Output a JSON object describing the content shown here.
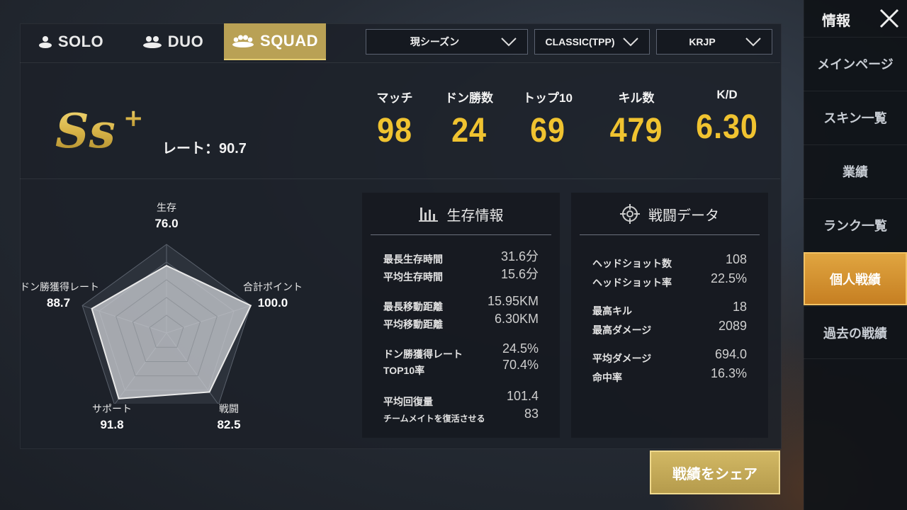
{
  "mode_tabs": [
    {
      "label": "SOLO",
      "active": false
    },
    {
      "label": "DUO",
      "active": false
    },
    {
      "label": "SQUAD",
      "active": true
    }
  ],
  "filters": {
    "season": "現シーズン",
    "mode": "CLASSIC(TPP)",
    "region": "KRJP"
  },
  "rank": {
    "tier_text": "Ss",
    "tier_plus": "+",
    "rating_label": "レート：90.7"
  },
  "summary_stats": [
    {
      "label": "マッチ",
      "value": "98"
    },
    {
      "label": "ドン勝数",
      "value": "24"
    },
    {
      "label": "トップ10",
      "value": "69"
    },
    {
      "label": "キル数",
      "value": "479"
    },
    {
      "label": "K/D",
      "value": "6.30"
    }
  ],
  "radar": {
    "axes": [
      {
        "label": "生存",
        "value": "76.0",
        "score": 76.0
      },
      {
        "label": "合計ポイント",
        "value": "100.0",
        "score": 100.0
      },
      {
        "label": "戦闘",
        "value": "82.5",
        "score": 82.5
      },
      {
        "label": "サポート",
        "value": "91.8",
        "score": 91.8
      },
      {
        "label": "ドン勝獲得レート",
        "value": "88.7",
        "score": 88.7
      }
    ]
  },
  "survival": {
    "title": "生存情報",
    "rows": [
      {
        "label": "最長生存時間",
        "value": "31.6分"
      },
      {
        "label": "平均生存時間",
        "value": "15.6分"
      },
      {
        "label": "最長移動距離",
        "value": "15.95KM"
      },
      {
        "label": "平均移動距離",
        "value": "6.30KM"
      },
      {
        "label": "ドン勝獲得レート",
        "value": "24.5%"
      },
      {
        "label": "TOP10率",
        "value": "70.4%"
      },
      {
        "label": "平均回復量",
        "value": "101.4"
      },
      {
        "label": "チームメイトを復活させる",
        "value": "83"
      }
    ]
  },
  "combat": {
    "title": "戦闘データ",
    "rows": [
      {
        "label": "ヘッドショット数",
        "value": "108"
      },
      {
        "label": "ヘッドショット率",
        "value": "22.5%"
      },
      {
        "label": "最高キル",
        "value": "18"
      },
      {
        "label": "最高ダメージ",
        "value": "2089"
      },
      {
        "label": "平均ダメージ",
        "value": "694.0"
      },
      {
        "label": "命中率",
        "value": "16.3%"
      }
    ]
  },
  "side_nav": {
    "title": "情報",
    "items": [
      {
        "label": "メインページ",
        "active": false
      },
      {
        "label": "スキン一覧",
        "active": false
      },
      {
        "label": "業績",
        "active": false
      },
      {
        "label": "ランク一覧",
        "active": false
      },
      {
        "label": "個人戦績",
        "active": true
      },
      {
        "label": "過去の戦績",
        "active": false
      }
    ]
  },
  "share_button": "戦績をシェア",
  "colors": {
    "accent_gold": "#f0c330",
    "tab_active": "#b9a155",
    "nav_active": "#d89a35"
  }
}
